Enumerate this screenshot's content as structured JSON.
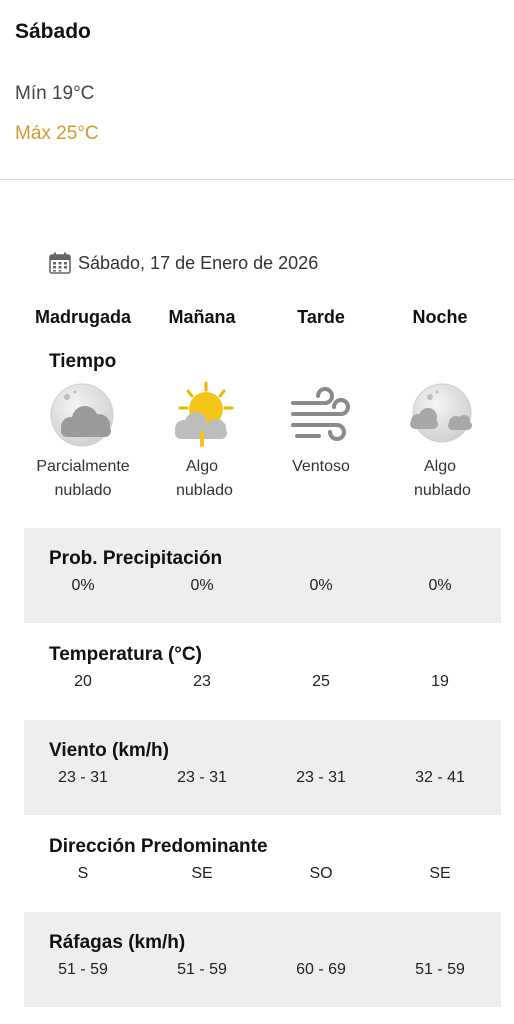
{
  "summary": {
    "day": "Sábado",
    "min": "Mín 19°C",
    "max": "Máx 25°C"
  },
  "forecast": {
    "date": "Sábado, 17 de Enero de 2026",
    "periods": [
      "Madrugada",
      "Mañana",
      "Tarde",
      "Noche"
    ],
    "weather_label": "Tiempo",
    "conditions": [
      {
        "icon": "partly-cloudy-night-icon",
        "text": "Parcialmente nublado"
      },
      {
        "icon": "sun-cloud-icon",
        "text": "Algo nublado"
      },
      {
        "icon": "wind-icon",
        "text": "Ventoso"
      },
      {
        "icon": "cloudy-night-icon",
        "text": "Algo nublado"
      }
    ],
    "rows": [
      {
        "label": "Prob. Precipitación",
        "values": [
          "0%",
          "0%",
          "0%",
          "0%"
        ]
      },
      {
        "label": "Temperatura (°C)",
        "values": [
          "20",
          "23",
          "25",
          "19"
        ]
      },
      {
        "label": "Viento (km/h)",
        "values": [
          "23 - 31",
          "23 - 31",
          "23 - 31",
          "32 - 41"
        ]
      },
      {
        "label": "Dirección Predominante",
        "values": [
          "S",
          "SE",
          "SO",
          "SE"
        ]
      },
      {
        "label": "Ráfagas (km/h)",
        "values": [
          "51 - 59",
          "51 - 59",
          "60 - 69",
          "51 - 59"
        ]
      }
    ]
  },
  "colors": {
    "max_temp": "#d29a2c",
    "band_gray": "#eeeeee",
    "sun": "#f5c518"
  }
}
